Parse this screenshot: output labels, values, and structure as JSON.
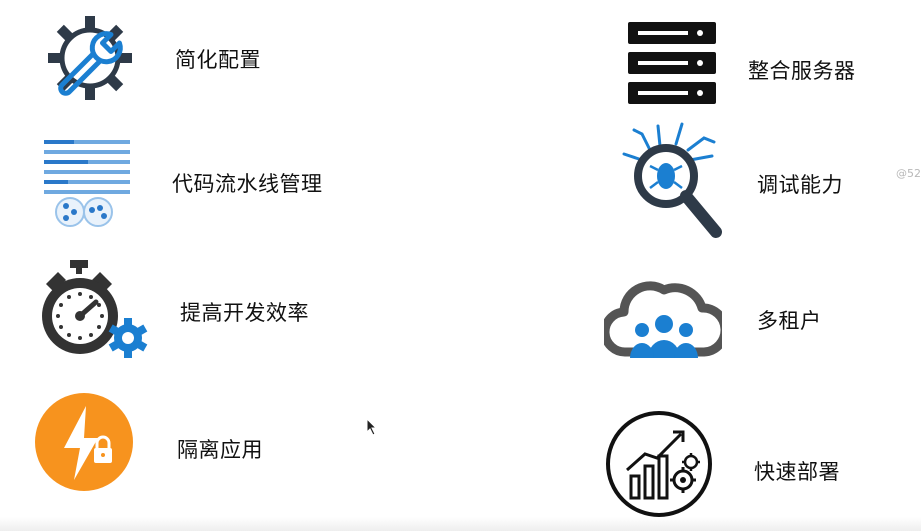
{
  "features_left": [
    {
      "label": "简化配置",
      "icon": "wrench-gear-icon"
    },
    {
      "label": "代码流水线管理",
      "icon": "pipeline-icon"
    },
    {
      "label": "提高开发效率",
      "icon": "stopwatch-gear-icon"
    },
    {
      "label": "隔离应用",
      "icon": "lightning-lock-icon"
    }
  ],
  "features_right": [
    {
      "label": "整合服务器",
      "icon": "server-stack-icon"
    },
    {
      "label": "调试能力",
      "icon": "bug-magnifier-icon"
    },
    {
      "label": "多租户",
      "icon": "cloud-users-icon"
    },
    {
      "label": "快速部署",
      "icon": "growth-chart-icon"
    }
  ],
  "watermark": "@52",
  "colors": {
    "blue": "#1b7fd1",
    "dark": "#333333",
    "orange": "#f7931e",
    "black": "#111111"
  }
}
